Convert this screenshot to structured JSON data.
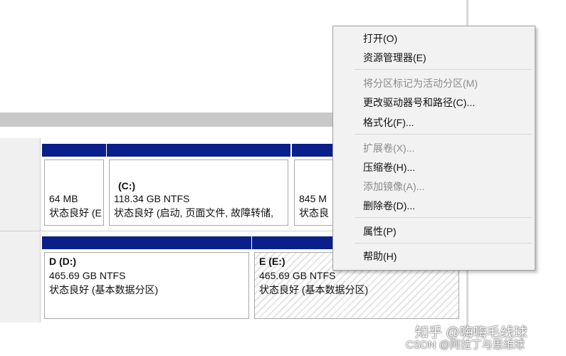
{
  "disks": [
    {
      "partitions": [
        {
          "title": "",
          "size": "64 MB",
          "status": "状态良好 (E"
        },
        {
          "title": "(C:)",
          "size": "118.34 GB NTFS",
          "status": "状态良好 (启动, 页面文件, 故障转储,"
        },
        {
          "title": "",
          "size": "845 M",
          "status": "状态良"
        }
      ]
    },
    {
      "partitions": [
        {
          "title": "D  (D:)",
          "size": "465.69 GB NTFS",
          "status": "状态良好 (基本数据分区)"
        },
        {
          "title": "E  (E:)",
          "size": "465.69 GB NTFS",
          "status": "状态良好 (基本数据分区)"
        }
      ]
    }
  ],
  "context_menu": {
    "items": [
      {
        "label": "打开(O)",
        "enabled": true
      },
      {
        "label": "资源管理器(E)",
        "enabled": true
      },
      {
        "label": "将分区标记为活动分区(M)",
        "enabled": false
      },
      {
        "label": "更改驱动器号和路径(C)...",
        "enabled": true
      },
      {
        "label": "格式化(F)...",
        "enabled": true
      },
      {
        "label": "扩展卷(X)...",
        "enabled": false
      },
      {
        "label": "压缩卷(H)...",
        "enabled": true
      },
      {
        "label": "添加镜像(A)...",
        "enabled": false
      },
      {
        "label": "删除卷(D)...",
        "enabled": true
      },
      {
        "label": "属性(P)",
        "enabled": true
      },
      {
        "label": "帮助(H)",
        "enabled": true
      }
    ]
  },
  "watermark": {
    "line1": "知乎 @嗨嗨毛线球",
    "line2": "CSDN @阿拉丁与思维球"
  },
  "colors": {
    "partition_bar": "#0b1f8a",
    "disabled_text": "#8a8a8a"
  }
}
